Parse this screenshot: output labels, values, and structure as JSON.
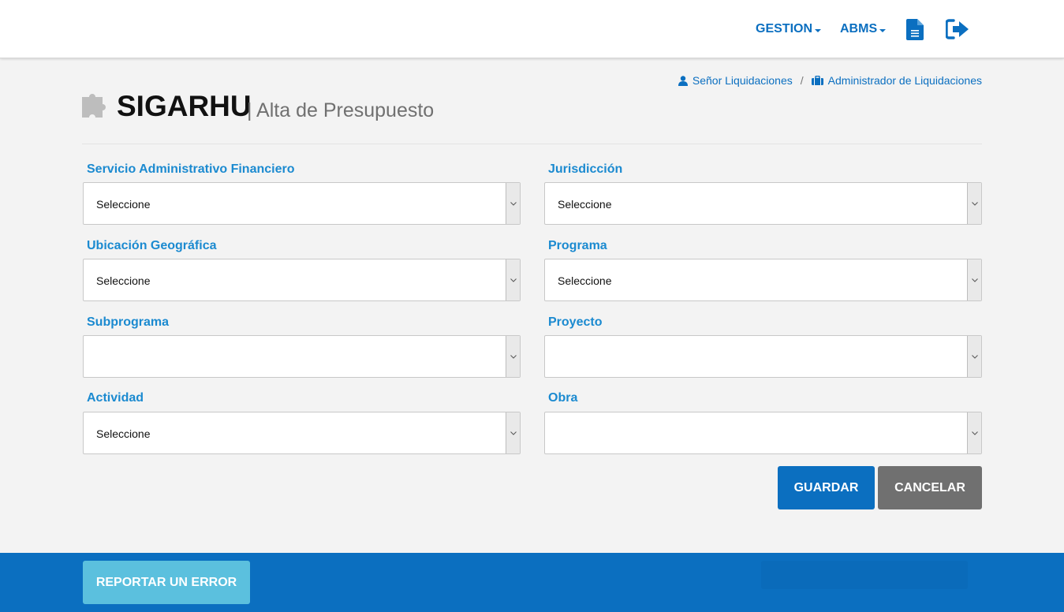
{
  "nav": {
    "menu": [
      {
        "label": "GESTION"
      },
      {
        "label": "ABMS"
      }
    ],
    "icons": [
      "document-icon",
      "logout-icon"
    ]
  },
  "breadcrumb": {
    "user": "Señor Liquidaciones",
    "separator": "/",
    "role": "Administrador de Liquidaciones"
  },
  "header": {
    "title": "SIGARHU",
    "subtitle": "| Alta de Presupuesto"
  },
  "form": {
    "fields": [
      {
        "label": "Servicio Administrativo Financiero",
        "value": "Seleccione"
      },
      {
        "label": "Jurisdicción",
        "value": "Seleccione"
      },
      {
        "label": "Ubicación Geográfica",
        "value": "Seleccione"
      },
      {
        "label": "Programa",
        "value": "Seleccione"
      },
      {
        "label": "Subprograma",
        "value": ""
      },
      {
        "label": "Proyecto",
        "value": ""
      },
      {
        "label": "Actividad",
        "value": "Seleccione"
      },
      {
        "label": "Obra",
        "value": ""
      }
    ]
  },
  "actions": {
    "save": "GUARDAR",
    "cancel": "CANCELAR"
  },
  "footer": {
    "report": "REPORTAR UN ERROR"
  },
  "colors": {
    "primary": "#0b6fc0",
    "label": "#1b8ad0",
    "cancel": "#707070",
    "report": "#5bc0de",
    "background": "#f3f3f3"
  }
}
